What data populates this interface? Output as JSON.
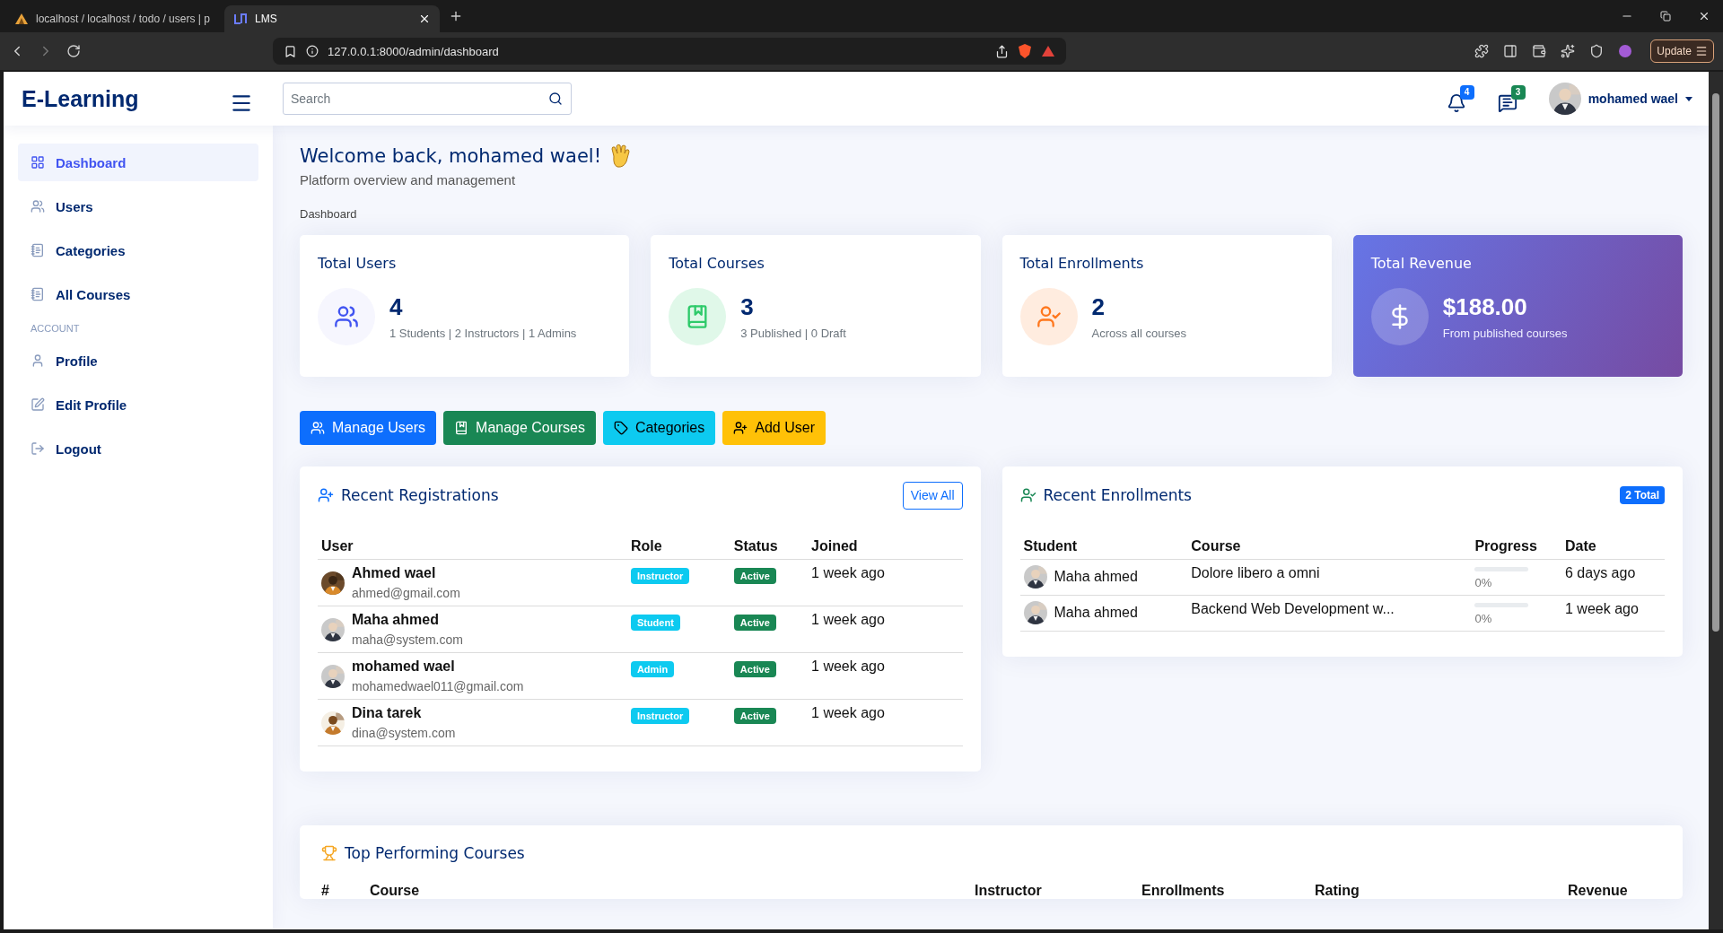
{
  "browser": {
    "tabs": [
      {
        "title": "localhost / localhost / todo / users | p",
        "selected": false
      },
      {
        "title": "LMS",
        "selected": true
      }
    ],
    "address": "127.0.0.1:8000/admin/dashboard",
    "update_button": "Update"
  },
  "header": {
    "logo": "E-Learning",
    "search": {
      "placeholder": "Search"
    },
    "notifications_count": "4",
    "messages_count": "3",
    "user_name": "mohamed wael"
  },
  "sidebar": {
    "items": [
      {
        "label": "Dashboard",
        "selected": true
      },
      {
        "label": "Users",
        "selected": false
      },
      {
        "label": "Categories",
        "selected": false
      },
      {
        "label": "All Courses",
        "selected": false
      }
    ],
    "account_heading": "ACCOUNT",
    "account_items": [
      {
        "label": "Profile",
        "selected": false
      },
      {
        "label": "Edit Profile",
        "selected": false
      },
      {
        "label": "Logout",
        "selected": false
      }
    ]
  },
  "page": {
    "title": "Welcome back, mohamed wael!",
    "subtitle": "Platform overview and management",
    "breadcrumb": "Dashboard"
  },
  "stats": [
    {
      "kind": "users",
      "title": "Total Users",
      "value": "4",
      "detail": "1 Students | 2 Instructors | 1 Admins"
    },
    {
      "kind": "courses",
      "title": "Total Courses",
      "value": "3",
      "detail": "3 Published | 0 Draft"
    },
    {
      "kind": "enrollments",
      "title": "Total Enrollments",
      "value": "2",
      "detail": "Across all courses"
    },
    {
      "kind": "revenue",
      "title": "Total Revenue",
      "value": "$188.00",
      "detail": "From published courses"
    }
  ],
  "actions": [
    {
      "kind": "users",
      "label": "Manage Users"
    },
    {
      "kind": "courses",
      "label": "Manage Courses"
    },
    {
      "kind": "categories",
      "label": "Categories"
    },
    {
      "kind": "add-user",
      "label": "Add User"
    }
  ],
  "recent_registrations": {
    "title": "Recent Registrations",
    "view_all": "View All",
    "columns": [
      "User",
      "Role",
      "Status",
      "Joined"
    ],
    "rows": [
      {
        "name": "Ahmed wael",
        "email": "ahmed@gmail.com",
        "role": "Instructor",
        "status": "Active",
        "joined": "1 week ago"
      },
      {
        "name": "Maha ahmed",
        "email": "maha@system.com",
        "role": "Student",
        "status": "Active",
        "joined": "1 week ago"
      },
      {
        "name": "mohamed wael",
        "email": "mohamedwael011@gmail.com",
        "role": "Admin",
        "status": "Active",
        "joined": "1 week ago"
      },
      {
        "name": "Dina tarek",
        "email": "dina@system.com",
        "role": "Instructor",
        "status": "Active",
        "joined": "1 week ago"
      }
    ]
  },
  "recent_enrollments": {
    "title": "Recent Enrollments",
    "badge": "2 Total",
    "columns": [
      "Student",
      "Course",
      "Progress",
      "Date"
    ],
    "rows": [
      {
        "student": "Maha ahmed",
        "course": "Dolore libero a omni",
        "level": 0,
        "progress": "0%",
        "date": "6 days ago"
      },
      {
        "student": "Maha ahmed",
        "course": "Backend Web Development w...",
        "level": 0,
        "progress": "0%",
        "date": "1 week ago"
      }
    ]
  },
  "top_courses": {
    "title": "Top Performing Courses",
    "columns": [
      "#",
      "Course",
      "Instructor",
      "Enrollments",
      "Rating",
      "Revenue"
    ]
  }
}
